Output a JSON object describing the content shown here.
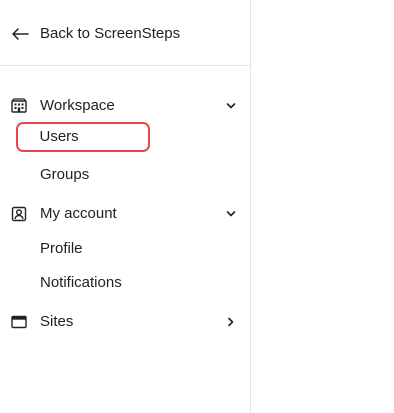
{
  "sidebar": {
    "back": {
      "label": "Back to ScreenSteps",
      "icon": "arrow-left-icon"
    },
    "sections": [
      {
        "label": "Workspace",
        "icon": "building-icon",
        "expanded": true,
        "items": [
          {
            "label": "Users",
            "selected": true
          },
          {
            "label": "Groups",
            "selected": false
          }
        ]
      },
      {
        "label": "My account",
        "icon": "user-card-icon",
        "expanded": true,
        "items": [
          {
            "label": "Profile",
            "selected": false
          },
          {
            "label": "Notifications",
            "selected": false
          }
        ]
      },
      {
        "label": "Sites",
        "icon": "browser-window-icon",
        "expanded": false,
        "items": []
      }
    ]
  },
  "colors": {
    "highlight": "#e5484d",
    "divider": "#e6e6e6",
    "text": "#222222"
  }
}
